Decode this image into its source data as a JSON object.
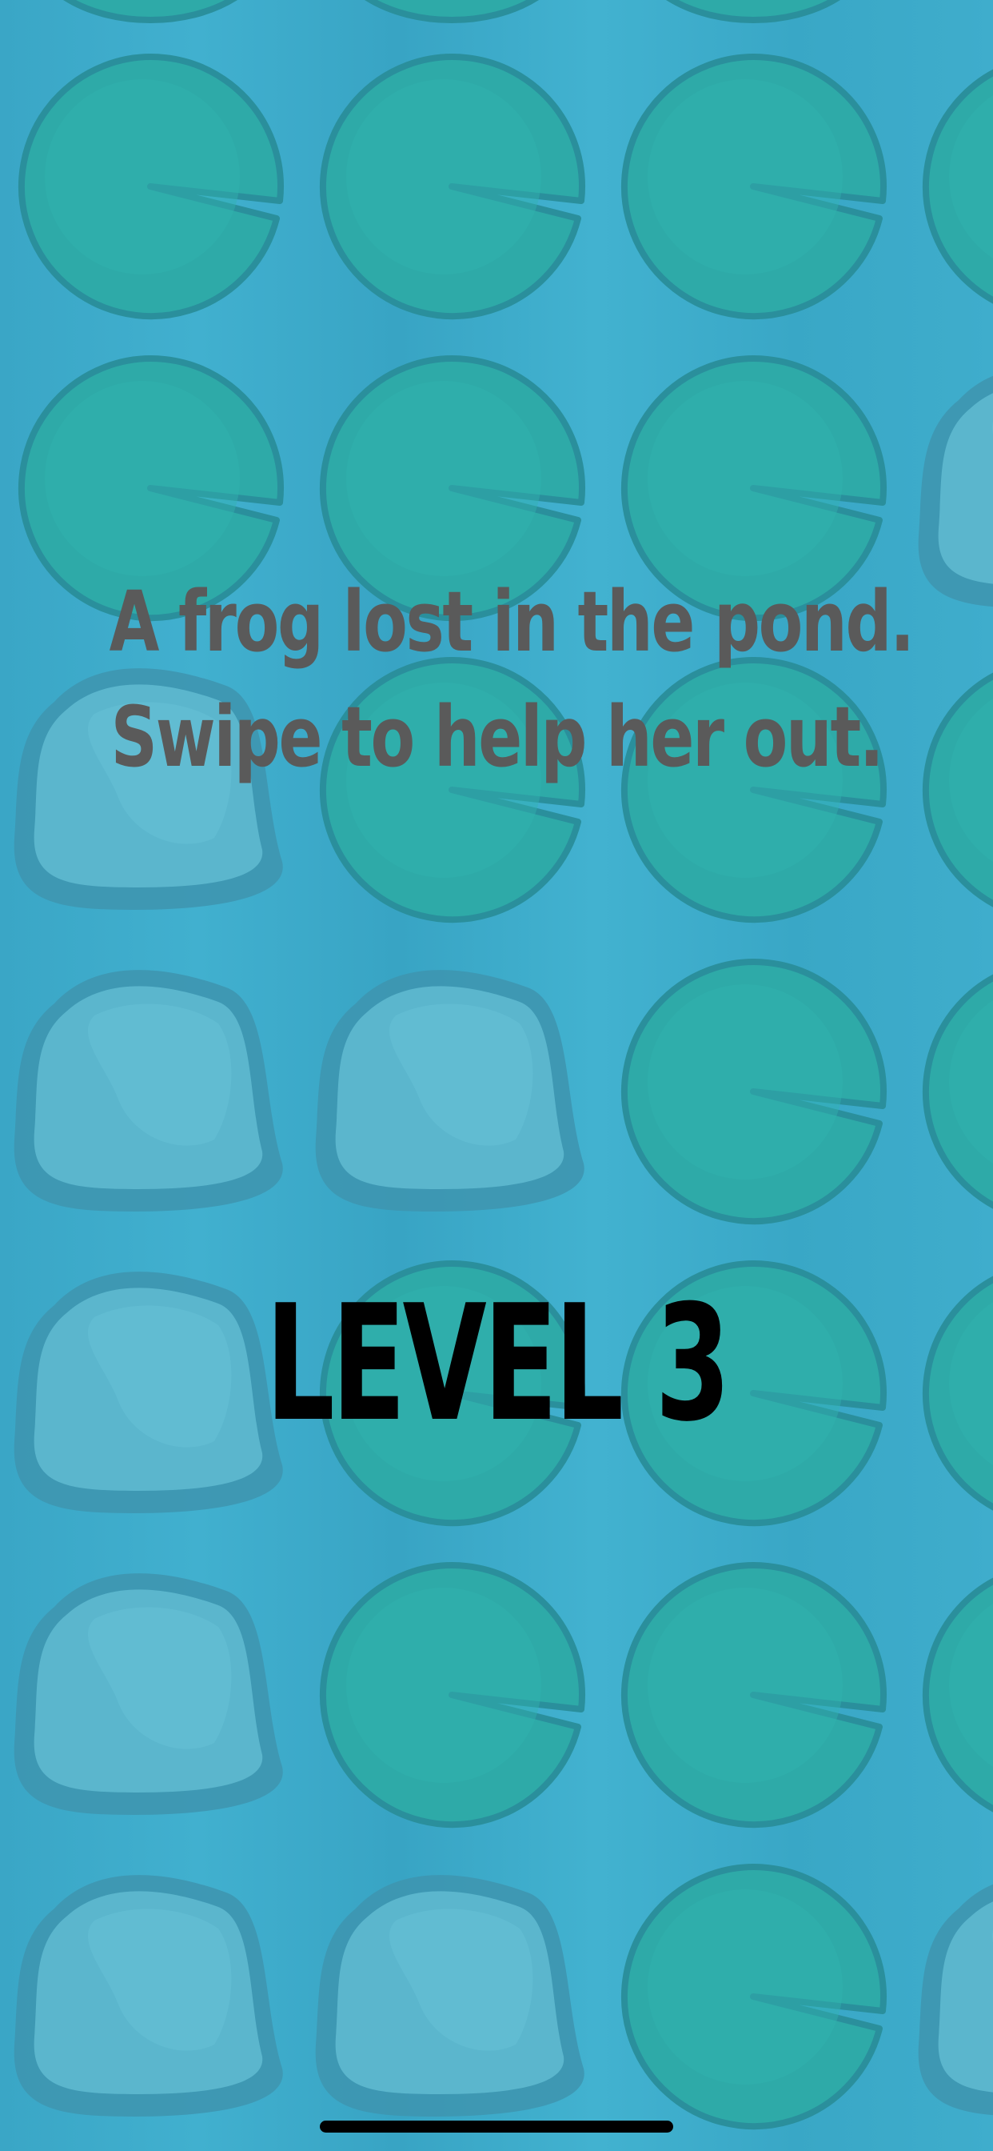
{
  "intro": {
    "line1": "A frog lost in the pond.",
    "line2": "Swipe to help her out."
  },
  "level": {
    "label": "LEVEL 3"
  },
  "board": {
    "rows": [
      [
        "pad",
        "pad",
        "pad",
        "pad"
      ],
      [
        "pad",
        "pad",
        "pad",
        "rock"
      ],
      [
        "rock",
        "pad",
        "pad",
        "pad"
      ],
      [
        "rock",
        "rock",
        "pad",
        "pad"
      ],
      [
        "rock",
        "pad",
        "pad",
        "pad"
      ],
      [
        "rock",
        "pad",
        "pad",
        "pad"
      ],
      [
        "rock",
        "rock",
        "pad",
        "rock"
      ]
    ]
  },
  "colors": {
    "water": "#3aa8c8",
    "lily_pad": "#2eaaa8",
    "lily_pad_edge": "#2a8f9c",
    "rock": "#5bb6cd",
    "rock_edge": "#3e96b0",
    "intro_text": "#5a5a5a",
    "level_text": "#000000"
  }
}
